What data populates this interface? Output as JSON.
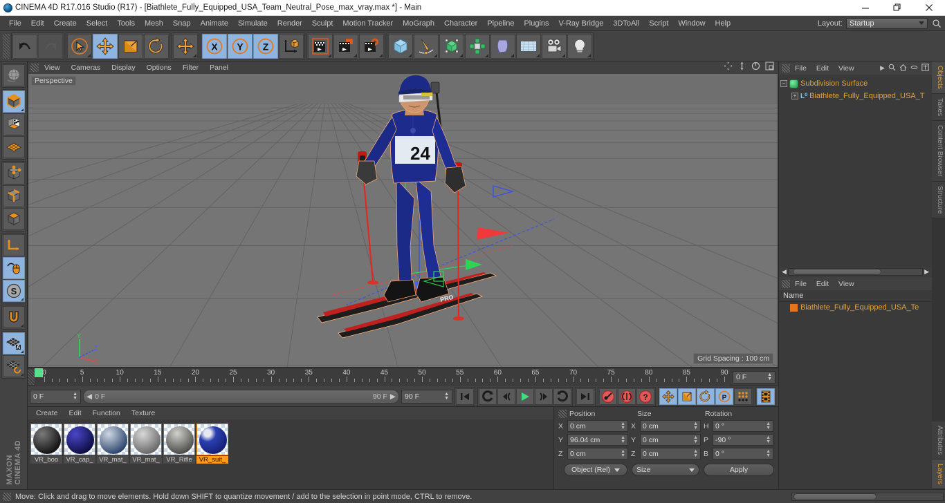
{
  "window": {
    "title": "CINEMA 4D R17.016 Studio (R17) - [Biathlete_Fully_Equipped_USA_Team_Neutral_Pose_max_vray.max *] - Main",
    "app_icon": "cinema4d-logo-icon",
    "minimize": "minimize-icon",
    "maximize": "restore-icon",
    "close": "close-icon"
  },
  "menubar": {
    "items": [
      {
        "label": "File"
      },
      {
        "label": "Edit"
      },
      {
        "label": "Create"
      },
      {
        "label": "Select"
      },
      {
        "label": "Tools"
      },
      {
        "label": "Mesh"
      },
      {
        "label": "Snap"
      },
      {
        "label": "Animate"
      },
      {
        "label": "Simulate"
      },
      {
        "label": "Render"
      },
      {
        "label": "Sculpt"
      },
      {
        "label": "Motion Tracker"
      },
      {
        "label": "MoGraph"
      },
      {
        "label": "Character"
      },
      {
        "label": "Pipeline"
      },
      {
        "label": "Plugins"
      },
      {
        "label": "V-Ray Bridge"
      },
      {
        "label": "3DToAll"
      },
      {
        "label": "Script"
      },
      {
        "label": "Window"
      },
      {
        "label": "Help"
      }
    ],
    "layout_label": "Layout:",
    "layout_value": "Startup",
    "search_icon": "search-icon"
  },
  "toolbar": {
    "groups": [
      {
        "name": "history",
        "buttons": [
          {
            "name": "undo-button",
            "icon": "undo-arrow-icon",
            "state": "normal"
          },
          {
            "name": "redo-button",
            "icon": "redo-arrow-icon",
            "state": "disabled"
          }
        ]
      },
      {
        "name": "transform-tools",
        "buttons": [
          {
            "name": "live-selection-tool",
            "icon": "cursor-circle-icon",
            "state": "normal"
          },
          {
            "name": "move-tool",
            "icon": "move-cross-icon",
            "state": "selected"
          },
          {
            "name": "scale-tool",
            "icon": "scale-box-icon",
            "state": "normal"
          },
          {
            "name": "rotate-tool",
            "icon": "rotate-circle-icon",
            "state": "normal"
          }
        ]
      },
      {
        "name": "position-group",
        "buttons": [
          {
            "name": "move-axis-tool",
            "icon": "move-cross-icon",
            "state": "normal"
          }
        ]
      },
      {
        "name": "axis-locks",
        "buttons": [
          {
            "name": "lock-x-axis",
            "icon": "x-axis-icon",
            "state": "selected"
          },
          {
            "name": "lock-y-axis",
            "icon": "y-axis-icon",
            "state": "selected"
          },
          {
            "name": "lock-z-axis",
            "icon": "z-axis-icon",
            "state": "selected"
          },
          {
            "name": "world-object-coordinates",
            "icon": "world-axis-cube-icon",
            "state": "normal"
          }
        ]
      },
      {
        "name": "render-group",
        "buttons": [
          {
            "name": "render-view",
            "icon": "render-clapper-icon",
            "state": "normal"
          },
          {
            "name": "render-to-picture-viewer",
            "icon": "render-picture-viewer-icon",
            "state": "normal"
          },
          {
            "name": "render-settings",
            "icon": "render-settings-gear-icon",
            "state": "normal"
          }
        ]
      },
      {
        "name": "objects-group",
        "buttons": [
          {
            "name": "add-cube-object",
            "icon": "cube-icon",
            "state": "normal"
          },
          {
            "name": "add-spline",
            "icon": "pen-spline-icon",
            "state": "normal"
          },
          {
            "name": "add-generator",
            "icon": "nurbs-cube-icon",
            "state": "normal"
          },
          {
            "name": "add-array",
            "icon": "array-icon",
            "state": "normal"
          },
          {
            "name": "add-deformer",
            "icon": "bend-deformer-icon",
            "state": "normal"
          },
          {
            "name": "add-floor-environment",
            "icon": "floor-grid-icon",
            "state": "normal"
          },
          {
            "name": "add-camera",
            "icon": "camera-icon",
            "state": "normal"
          },
          {
            "name": "add-light",
            "icon": "light-bulb-icon",
            "state": "normal"
          }
        ]
      }
    ]
  },
  "leftbar": {
    "groups": [
      {
        "buttons": [
          {
            "name": "undo-view-button",
            "icon": "globe-sphere-icon",
            "state": "normal"
          }
        ]
      },
      {
        "buttons": [
          {
            "name": "editable-object-mode",
            "icon": "cube-model-icon",
            "state": "selected"
          },
          {
            "name": "texture-mode",
            "icon": "checker-cube-icon",
            "state": "normal"
          },
          {
            "name": "workplane-mode",
            "icon": "workplane-grid-icon",
            "state": "normal"
          }
        ]
      },
      {
        "buttons": [
          {
            "name": "points-mode",
            "icon": "points-cube-icon",
            "state": "normal"
          },
          {
            "name": "edges-mode",
            "icon": "edges-cube-icon",
            "state": "normal"
          },
          {
            "name": "polygons-mode",
            "icon": "polygons-cube-icon",
            "state": "normal"
          }
        ]
      },
      {
        "buttons": [
          {
            "name": "enable-axis-modification",
            "icon": "axis-l-icon",
            "state": "normal"
          },
          {
            "name": "auto-switch-mode",
            "icon": "mouse-icon",
            "state": "selected"
          },
          {
            "name": "soft-selection",
            "icon": "soft-selection-s-icon",
            "state": "selected"
          }
        ]
      },
      {
        "buttons": [
          {
            "name": "enable-snap",
            "icon": "magnet-icon",
            "state": "normal"
          }
        ]
      },
      {
        "buttons": [
          {
            "name": "lock-workplane",
            "icon": "workplane-lock-icon",
            "state": "selected"
          },
          {
            "name": "planar-workplane",
            "icon": "workplane-rotate-icon",
            "state": "normal"
          }
        ]
      }
    ],
    "brand_line1": "MAXON",
    "brand_line2": "CINEMA 4D"
  },
  "viewport": {
    "menus": [
      {
        "label": "View"
      },
      {
        "label": "Cameras"
      },
      {
        "label": "Display"
      },
      {
        "label": "Options"
      },
      {
        "label": "Filter"
      },
      {
        "label": "Panel"
      }
    ],
    "label": "Perspective",
    "grid_spacing": "Grid Spacing : 100 cm",
    "icons": [
      {
        "name": "viewport-pan-icon"
      },
      {
        "name": "viewport-dolly-icon"
      },
      {
        "name": "viewport-orbit-icon"
      },
      {
        "name": "viewport-maximize-icon"
      }
    ],
    "axis_widget": {
      "x": "X",
      "y": "Y",
      "z": "Z"
    },
    "scene": {
      "object_label": "Biathlete with skis and poles",
      "bib_number": "24",
      "ski_text": "PRO"
    },
    "colors": {
      "sky": "#6d6d6d",
      "ground": "#737373",
      "grid_line": "#5f5f5f",
      "suit": "#1d2f8f",
      "ski": "#c41a1a",
      "axis_x": "#e03030",
      "axis_y": "#35c040",
      "axis_z": "#3050e0"
    }
  },
  "timeline": {
    "ticks": [
      0,
      5,
      10,
      15,
      20,
      25,
      30,
      35,
      40,
      45,
      50,
      55,
      60,
      65,
      70,
      75,
      80,
      85,
      90
    ],
    "range_min": 0,
    "range_max": 90,
    "current_frame_field": "0 F",
    "playhead_frame": 0
  },
  "animbar": {
    "start_field": "0 F",
    "range_left": "0 F",
    "range_right": "90 F",
    "end_field": "90 F",
    "buttons": [
      {
        "name": "go-to-start-button",
        "icon": "skip-start-icon",
        "state": "normal"
      },
      {
        "name": "go-to-previous-key-button",
        "icon": "rewind-key-icon",
        "state": "normal"
      },
      {
        "name": "go-to-previous-frame-button",
        "icon": "step-back-icon",
        "state": "normal"
      },
      {
        "name": "play-button",
        "icon": "play-icon",
        "state": "normal"
      },
      {
        "name": "go-to-next-frame-button",
        "icon": "step-forward-icon",
        "state": "normal"
      },
      {
        "name": "go-to-next-key-button",
        "icon": "forward-key-icon",
        "state": "normal"
      },
      {
        "name": "go-to-end-button",
        "icon": "skip-end-icon",
        "state": "normal"
      },
      {
        "name": "record-active-objects-button",
        "icon": "record-key-icon",
        "state": "normal"
      },
      {
        "name": "autokeying-button",
        "icon": "autokey-icon",
        "state": "normal"
      },
      {
        "name": "keyframe-selection-button",
        "icon": "question-key-icon",
        "state": "normal"
      },
      {
        "name": "position-key-toggle",
        "icon": "move-cross-icon",
        "state": "selected"
      },
      {
        "name": "scale-key-toggle",
        "icon": "scale-box-icon",
        "state": "selected"
      },
      {
        "name": "rotation-key-toggle",
        "icon": "rotate-circle-icon",
        "state": "selected"
      },
      {
        "name": "parameter-key-toggle",
        "icon": "parameter-p-icon",
        "state": "selected"
      },
      {
        "name": "point-level-animation-toggle",
        "icon": "pla-dots-icon",
        "state": "normal"
      },
      {
        "name": "timeline-button",
        "icon": "film-strip-icon",
        "state": "selected"
      }
    ]
  },
  "material_manager": {
    "menus": [
      {
        "label": "Create"
      },
      {
        "label": "Edit"
      },
      {
        "label": "Function"
      },
      {
        "label": "Texture"
      }
    ],
    "materials": [
      {
        "name": "VR_boo",
        "color": "#2b2b2b",
        "selected": false
      },
      {
        "name": "VR_cap_",
        "color": "#23227a",
        "selected": false
      },
      {
        "name": "VR_mat_",
        "color": "#7d8a9a",
        "selected": false
      },
      {
        "name": "VR_mat_",
        "color": "#9a9a9a",
        "selected": false
      },
      {
        "name": "VR_Rifle",
        "color": "#7a7a78",
        "selected": false
      },
      {
        "name": "VR_suit_",
        "color": "#1d2f8f",
        "selected": true
      }
    ]
  },
  "coordinates": {
    "headers": {
      "position": "Position",
      "size": "Size",
      "rotation": "Rotation"
    },
    "rows": [
      {
        "pos_label": "X",
        "pos_value": "0 cm",
        "size_label": "X",
        "size_value": "0 cm",
        "rot_label": "H",
        "rot_value": "0 °"
      },
      {
        "pos_label": "Y",
        "pos_value": "96.04 cm",
        "size_label": "Y",
        "size_value": "0 cm",
        "rot_label": "P",
        "rot_value": "-90 °"
      },
      {
        "pos_label": "Z",
        "pos_value": "0 cm",
        "size_label": "Z",
        "size_value": "0 cm",
        "rot_label": "B",
        "rot_value": "0 °"
      }
    ],
    "mode_select": "Object (Rel)",
    "size_select": "Size",
    "apply_button": "Apply"
  },
  "objects_panel": {
    "menus": [
      {
        "label": "File"
      },
      {
        "label": "Edit"
      },
      {
        "label": "View"
      }
    ],
    "icons": [
      {
        "name": "more-arrow-icon"
      },
      {
        "name": "search-icon"
      },
      {
        "name": "home-icon"
      },
      {
        "name": "ellipse-icon"
      },
      {
        "name": "expand-box-icon"
      }
    ],
    "tree": [
      {
        "label": "Subdivision Surface",
        "icon": "subdivision-surface-icon",
        "color": "#e0a23c",
        "level": 0
      },
      {
        "label": "Biathlete_Fully_Equipped_USA_T",
        "icon": "null-object-icon",
        "color": "#e0a23c",
        "level": 1
      }
    ]
  },
  "layers_panel": {
    "menus": [
      {
        "label": "File"
      },
      {
        "label": "Edit"
      },
      {
        "label": "View"
      }
    ],
    "column_header": "Name",
    "rows": [
      {
        "label": "Biathlete_Fully_Equipped_USA_Te",
        "swatch": "#e8731d"
      }
    ]
  },
  "right_tabs": [
    {
      "label": "Objects",
      "active": true
    },
    {
      "label": "Takes",
      "active": false
    },
    {
      "label": "Content Browser",
      "active": false
    },
    {
      "label": "Structure",
      "active": false
    },
    {
      "label": "Attributes",
      "active": false
    },
    {
      "label": "Layers",
      "active": true
    }
  ],
  "statusbar": {
    "message": "Move: Click and drag to move elements. Hold down SHIFT to quantize movement / add to the selection in point mode, CTRL to remove."
  }
}
